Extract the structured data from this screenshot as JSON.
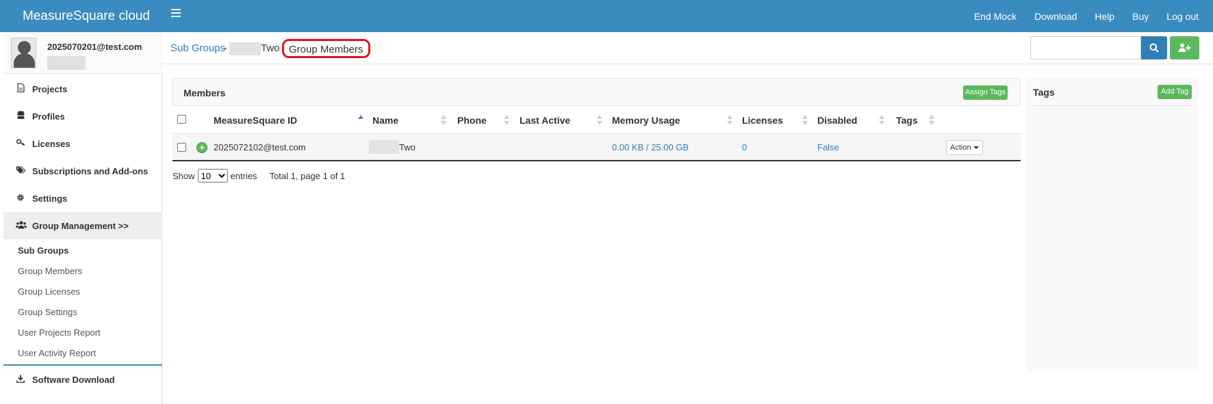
{
  "app": {
    "brand": "MeasureSquare cloud"
  },
  "topnav": {
    "items": [
      "End Mock",
      "Download",
      "Help",
      "Buy",
      "Log out"
    ]
  },
  "user": {
    "email": "2025070201@test.com"
  },
  "sidebar": {
    "items": [
      {
        "label": "Projects",
        "icon": "file-icon"
      },
      {
        "label": "Profiles",
        "icon": "database-icon"
      },
      {
        "label": "Licenses",
        "icon": "key-icon"
      },
      {
        "label": "Subscriptions and Add-ons",
        "icon": "tags-icon"
      },
      {
        "label": "Settings",
        "icon": "gear-icon"
      },
      {
        "label": "Group Management >>",
        "icon": "users-icon"
      }
    ],
    "subitems": [
      "Sub Groups",
      "Group Members",
      "Group Licenses",
      "Group Settings",
      "User Projects Report",
      "User Activity Report"
    ],
    "footer": {
      "label": "Software Download",
      "icon": "download-icon"
    }
  },
  "breadcrumb": {
    "link": "Sub Groups",
    "separator": " -",
    "group_suffix": "Two",
    "current": "Group Members"
  },
  "members": {
    "title": "Members",
    "assign_tags_label": "Assign Tags",
    "columns": [
      "MeasureSquare ID",
      "Name",
      "Phone",
      "Last Active",
      "Memory Usage",
      "Licenses",
      "Disabled",
      "Tags"
    ],
    "rows": [
      {
        "id": "2025072102@test.com",
        "name_suffix": "Two",
        "phone": "",
        "last_active": "",
        "memory": "0.00 KB / 25.00 GB",
        "licenses": "0",
        "disabled": "False",
        "tags": "",
        "action": "Action"
      }
    ]
  },
  "pagination": {
    "show": "Show",
    "page_size": "10",
    "entries": "entries",
    "total": "Total 1, page 1 of 1"
  },
  "tags": {
    "title": "Tags",
    "add_label": "Add Tag"
  },
  "colors": {
    "primary": "#3a8bbf",
    "link": "#2f7fb5",
    "success": "#5cb85c",
    "highlight": "#e0141e"
  }
}
